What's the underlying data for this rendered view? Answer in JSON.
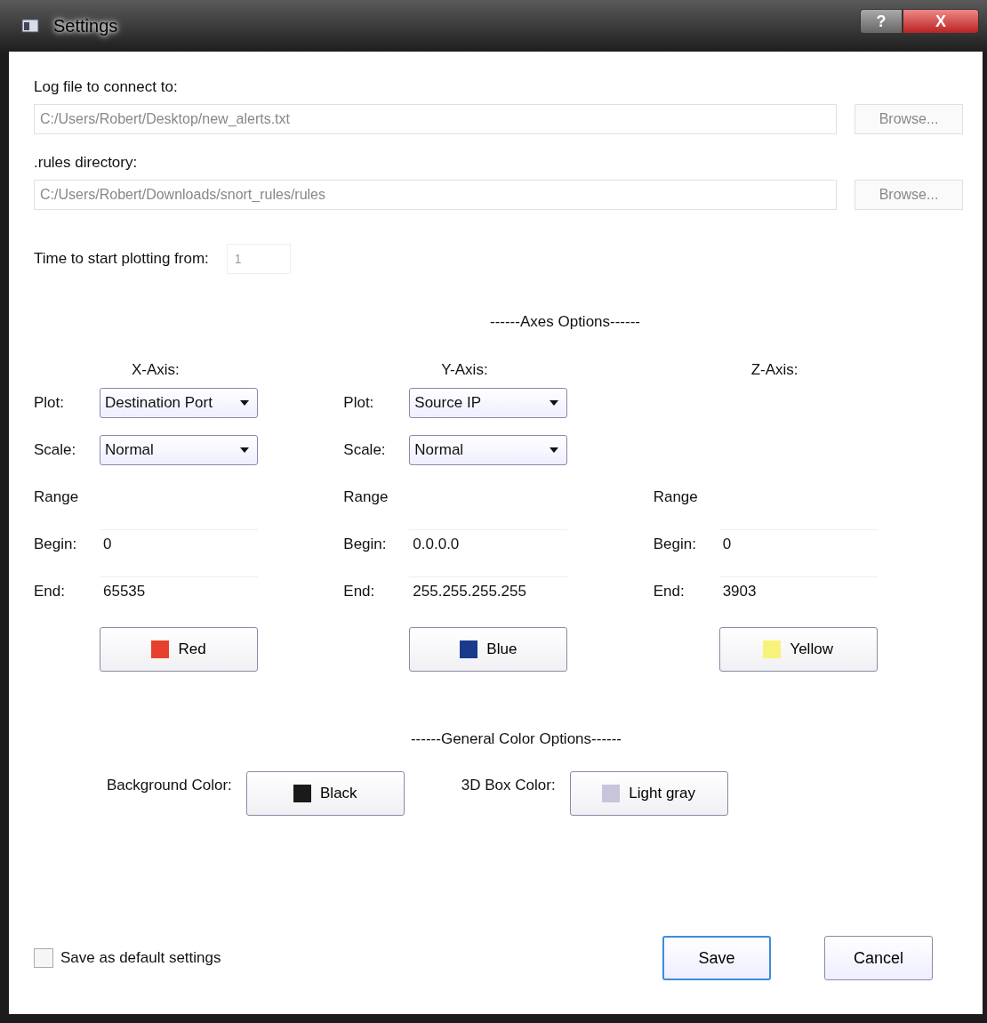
{
  "window": {
    "title": "Settings",
    "help_button": "?",
    "close_button": "X"
  },
  "log_file": {
    "label": "Log file to connect to:",
    "value": "C:/Users/Robert/Desktop/new_alerts.txt",
    "browse": "Browse..."
  },
  "rules_dir": {
    "label": ".rules directory:",
    "value": "C:/Users/Robert/Downloads/snort_rules/rules",
    "browse": "Browse..."
  },
  "time_start": {
    "label": "Time to start plotting from:",
    "value": "1"
  },
  "axes_heading": "------Axes Options------",
  "axes": [
    {
      "title": "X-Axis:",
      "plot": {
        "label": "Plot:",
        "value": "Destination Port"
      },
      "scale": {
        "label": "Scale:",
        "value": "Normal"
      },
      "range_label": "Range",
      "begin": {
        "label": "Begin:",
        "value": "0"
      },
      "end": {
        "label": "End:",
        "value": "65535"
      },
      "color": {
        "label": "Red",
        "color": "#e8402e"
      }
    },
    {
      "title": "Y-Axis:",
      "plot": {
        "label": "Plot:",
        "value": "Source IP"
      },
      "scale": {
        "label": "Scale:",
        "value": "Normal"
      },
      "range_label": "Range",
      "begin": {
        "label": "Begin:",
        "value": "0.0.0.0"
      },
      "end": {
        "label": "End:",
        "value": "255.255.255.255"
      },
      "color": {
        "label": "Blue",
        "color": "#1a3a8c"
      }
    },
    {
      "title": "Z-Axis:",
      "range_label": "Range",
      "begin": {
        "label": "Begin:",
        "value": "0"
      },
      "end": {
        "label": "End:",
        "value": "3903"
      },
      "color": {
        "label": "Yellow",
        "color": "#f8f27a"
      }
    }
  ],
  "general_heading": "------General Color Options------",
  "general_colors": [
    {
      "label": "Background Color:",
      "button": "Black",
      "color": "#1a1a1a"
    },
    {
      "label": "3D Box Color:",
      "button": "Light gray",
      "color": "#c8c4dc"
    }
  ],
  "save_default": {
    "label": "Save as default settings",
    "checked": false
  },
  "buttons": [
    {
      "label": "Save",
      "kind": "default"
    },
    {
      "label": "Cancel",
      "kind": "normal"
    }
  ]
}
